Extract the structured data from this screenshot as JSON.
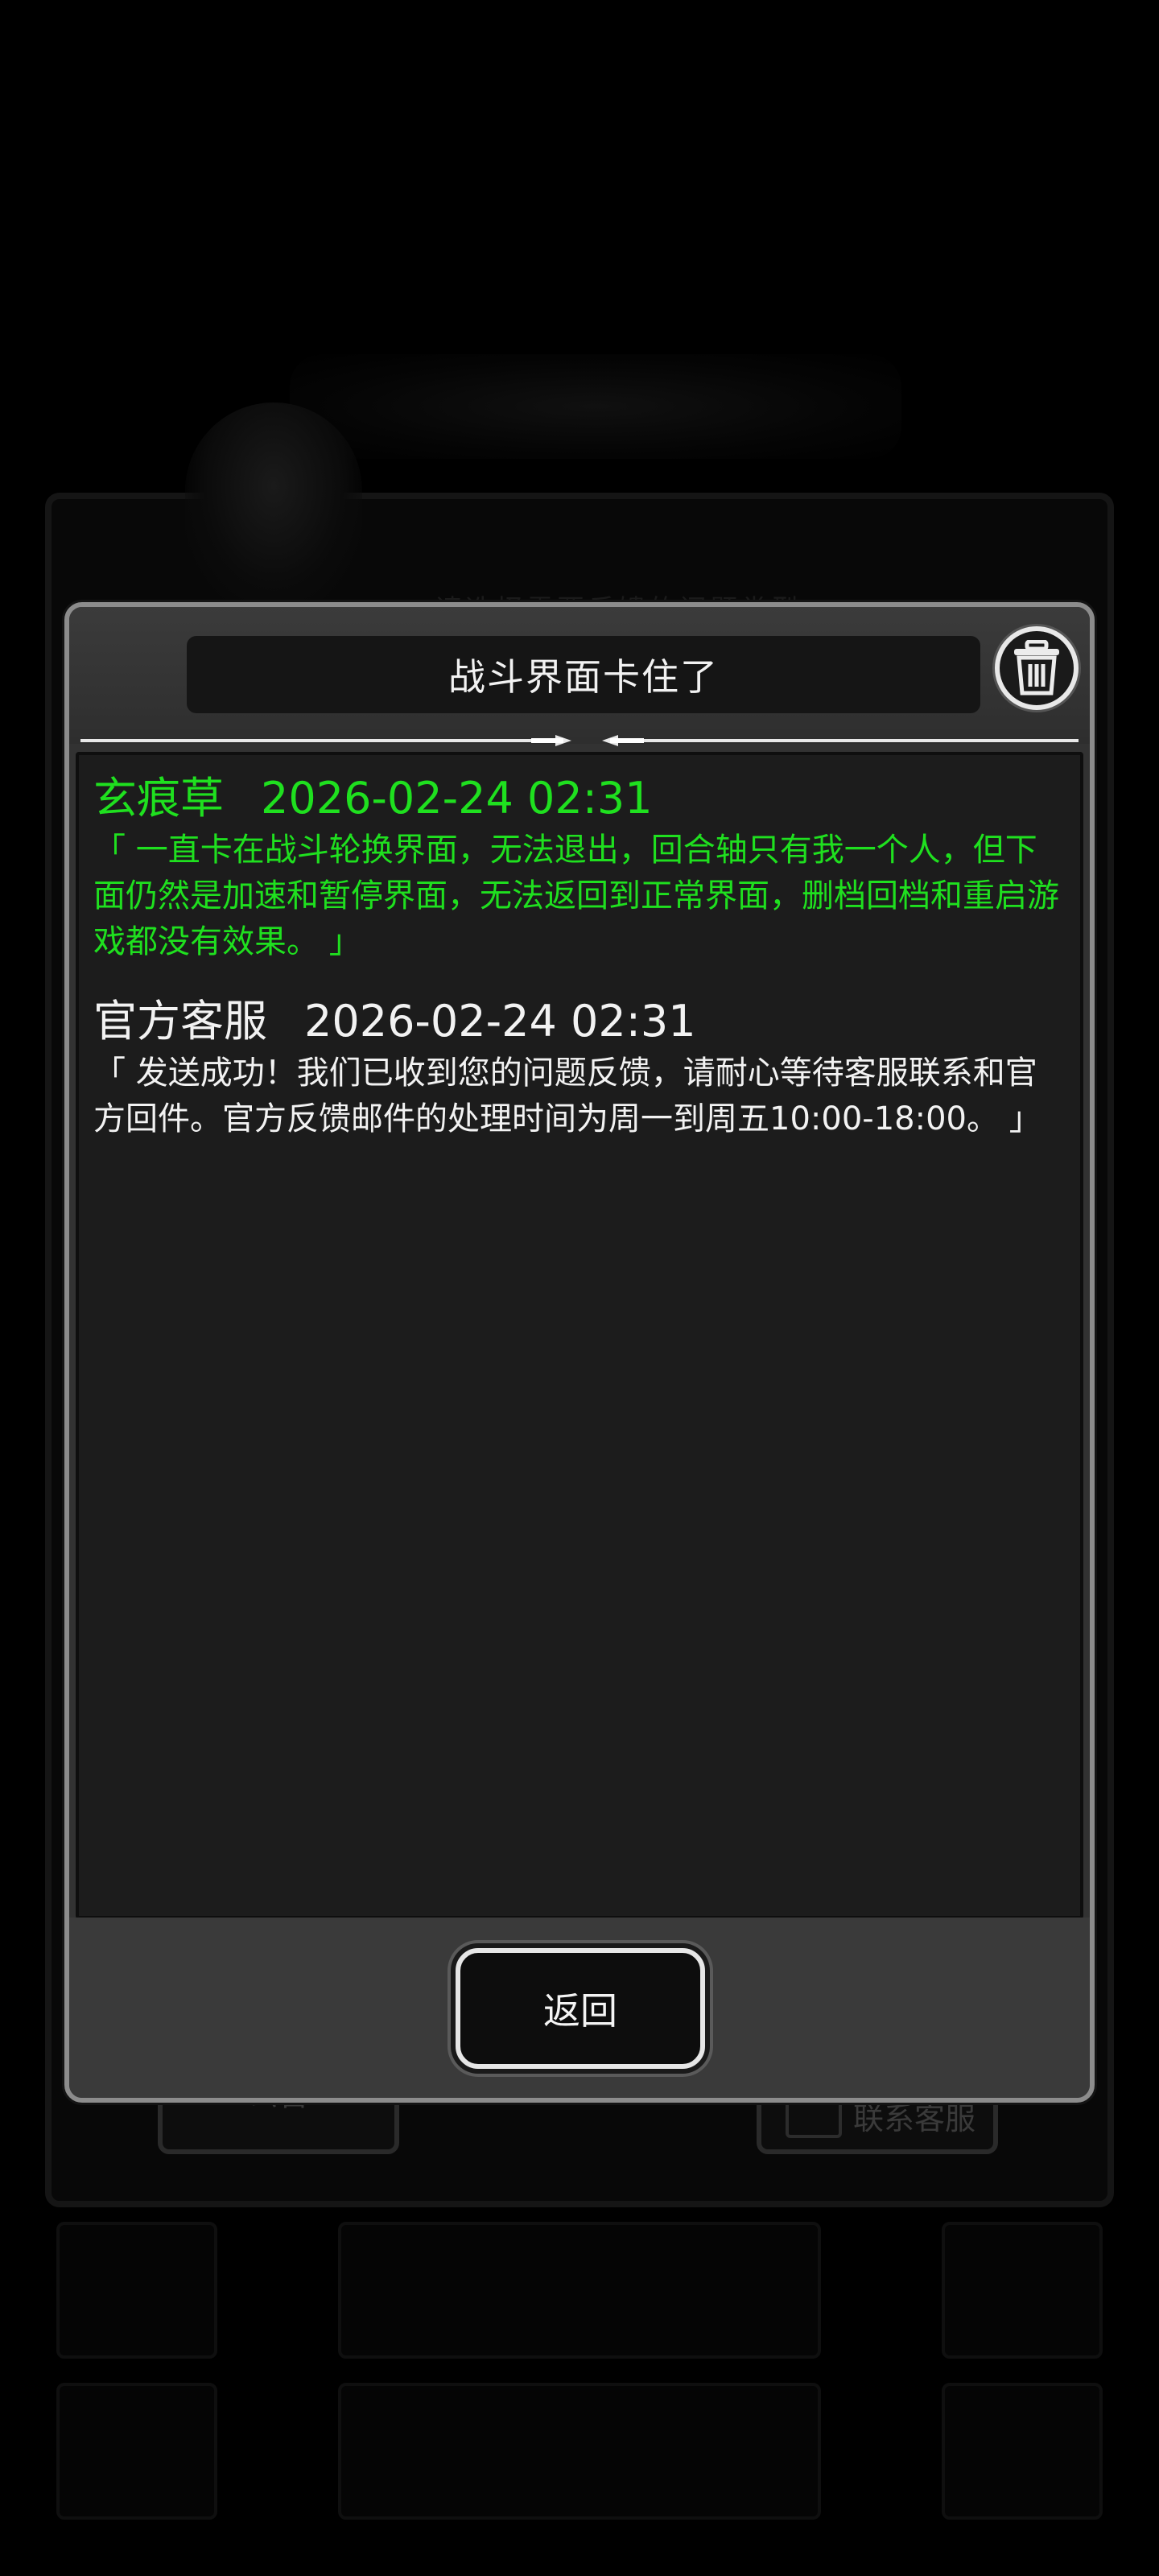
{
  "background": {
    "subtitle": "请选择需要反馈的问题类型",
    "left_button_label": "公告",
    "right_button_label": "联系客服"
  },
  "dialog": {
    "title": "战斗界面卡住了",
    "delete_icon": "trash-icon",
    "messages": [
      {
        "sender": "玄痕草",
        "time": "2026-02-24 02:31",
        "text": "「 一直卡在战斗轮换界面，无法退出，回合轴只有我一个人，但下面仍然是加速和暂停界面，无法返回到正常界面，删档回档和重启游戏都没有效果。 」",
        "color": "#1fe01f"
      },
      {
        "sender": "官方客服",
        "time": "2026-02-24 02:31",
        "text": "「 发送成功！我们已收到您的问题反馈，请耐心等待客服联系和官方回件。官方反馈邮件的处理时间为周一到周五10:00-18:00。 」",
        "color": "#f2f2f2"
      }
    ],
    "back_label": "返回"
  }
}
